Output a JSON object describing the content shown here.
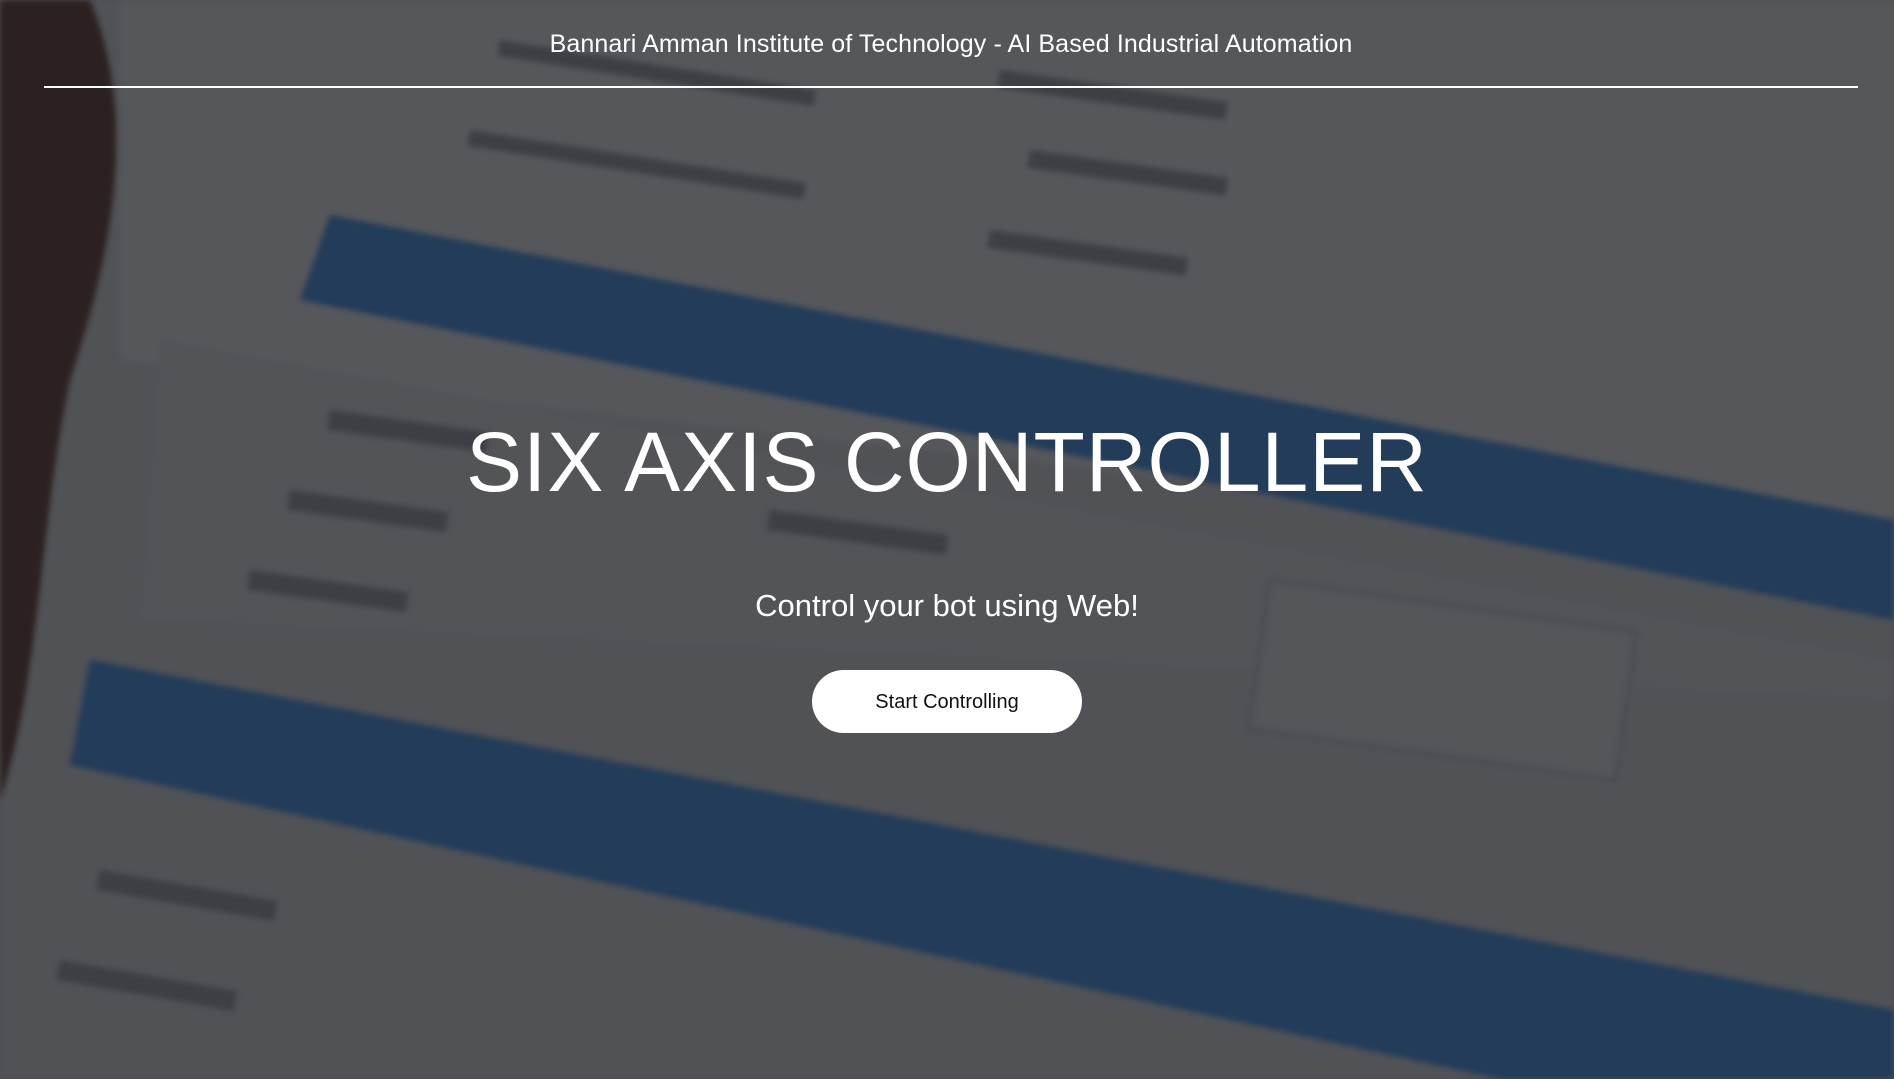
{
  "header": {
    "title": "Bannari Amman Institute of Technology - AI Based Industrial Automation"
  },
  "hero": {
    "title": "SIX AXIS CONTROLLER",
    "subtitle": "Control your bot using Web!",
    "cta_label": "Start Controlling"
  },
  "colors": {
    "overlay": "#14161a",
    "text": "#ffffff",
    "button_bg": "#ffffff",
    "button_text": "#111111",
    "background_accent_blue": "#2f7fd6"
  }
}
